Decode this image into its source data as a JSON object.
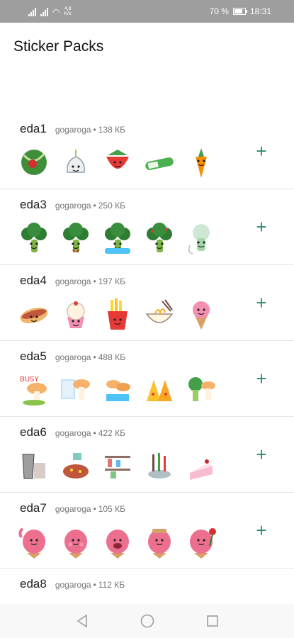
{
  "status_bar": {
    "network_speed": "4,8\nK/s",
    "battery_text": "70 %",
    "battery_level": 0.7,
    "time": "18:31"
  },
  "app_bar": {
    "title": "Sticker Packs"
  },
  "packs": [
    {
      "name": "eda1",
      "author": "gogaroga",
      "size": "138 КБ",
      "stickers": [
        "watermelon-sticker",
        "garlic-sticker",
        "strawberry-sticker",
        "cucumber-sticker",
        "carrot-sticker"
      ]
    },
    {
      "name": "eda3",
      "author": "gogaroga",
      "size": "250 КБ",
      "stickers": [
        "broccoli-sticker",
        "broccoli-sad-sticker",
        "broccoli-crying-sticker",
        "broccoli-angry-sticker",
        "broccoli-ghost-sticker"
      ]
    },
    {
      "name": "eda4",
      "author": "gogaroga",
      "size": "197 КБ",
      "stickers": [
        "hotdog-sticker",
        "cupcake-sticker",
        "fries-sticker",
        "noodle-bowl-sticker",
        "ice-cream-sticker"
      ]
    },
    {
      "name": "eda5",
      "author": "gogaroga",
      "size": "488 КБ",
      "stickers": [
        "mushroom-busy-sticker",
        "mushroom-drawing-sticker",
        "mushroom-crowd-sticker",
        "pizza-friends-sticker",
        "broccoli-friends-sticker"
      ]
    },
    {
      "name": "eda6",
      "author": "gogaroga",
      "size": "422 КБ",
      "stickers": [
        "coffee-maker-sticker",
        "pizza-sticker",
        "kitchen-shelf-sticker",
        "cookware-sticker",
        "cake-slice-sticker"
      ]
    },
    {
      "name": "eda7",
      "author": "gogaroga",
      "size": "105 КБ",
      "stickers": [
        "pink-icecream-wave-sticker",
        "pink-icecream-shy-sticker",
        "pink-icecream-laugh-sticker",
        "pink-icecream-sad-sticker",
        "pink-icecream-rose-sticker"
      ]
    },
    {
      "name": "eda8",
      "author": "gogaroga",
      "size": "112 КБ",
      "stickers": []
    }
  ],
  "separator": "•",
  "add_label": "+",
  "colors": {
    "accent": "#2e8b6a",
    "status_bar": "#9e9e9e"
  }
}
